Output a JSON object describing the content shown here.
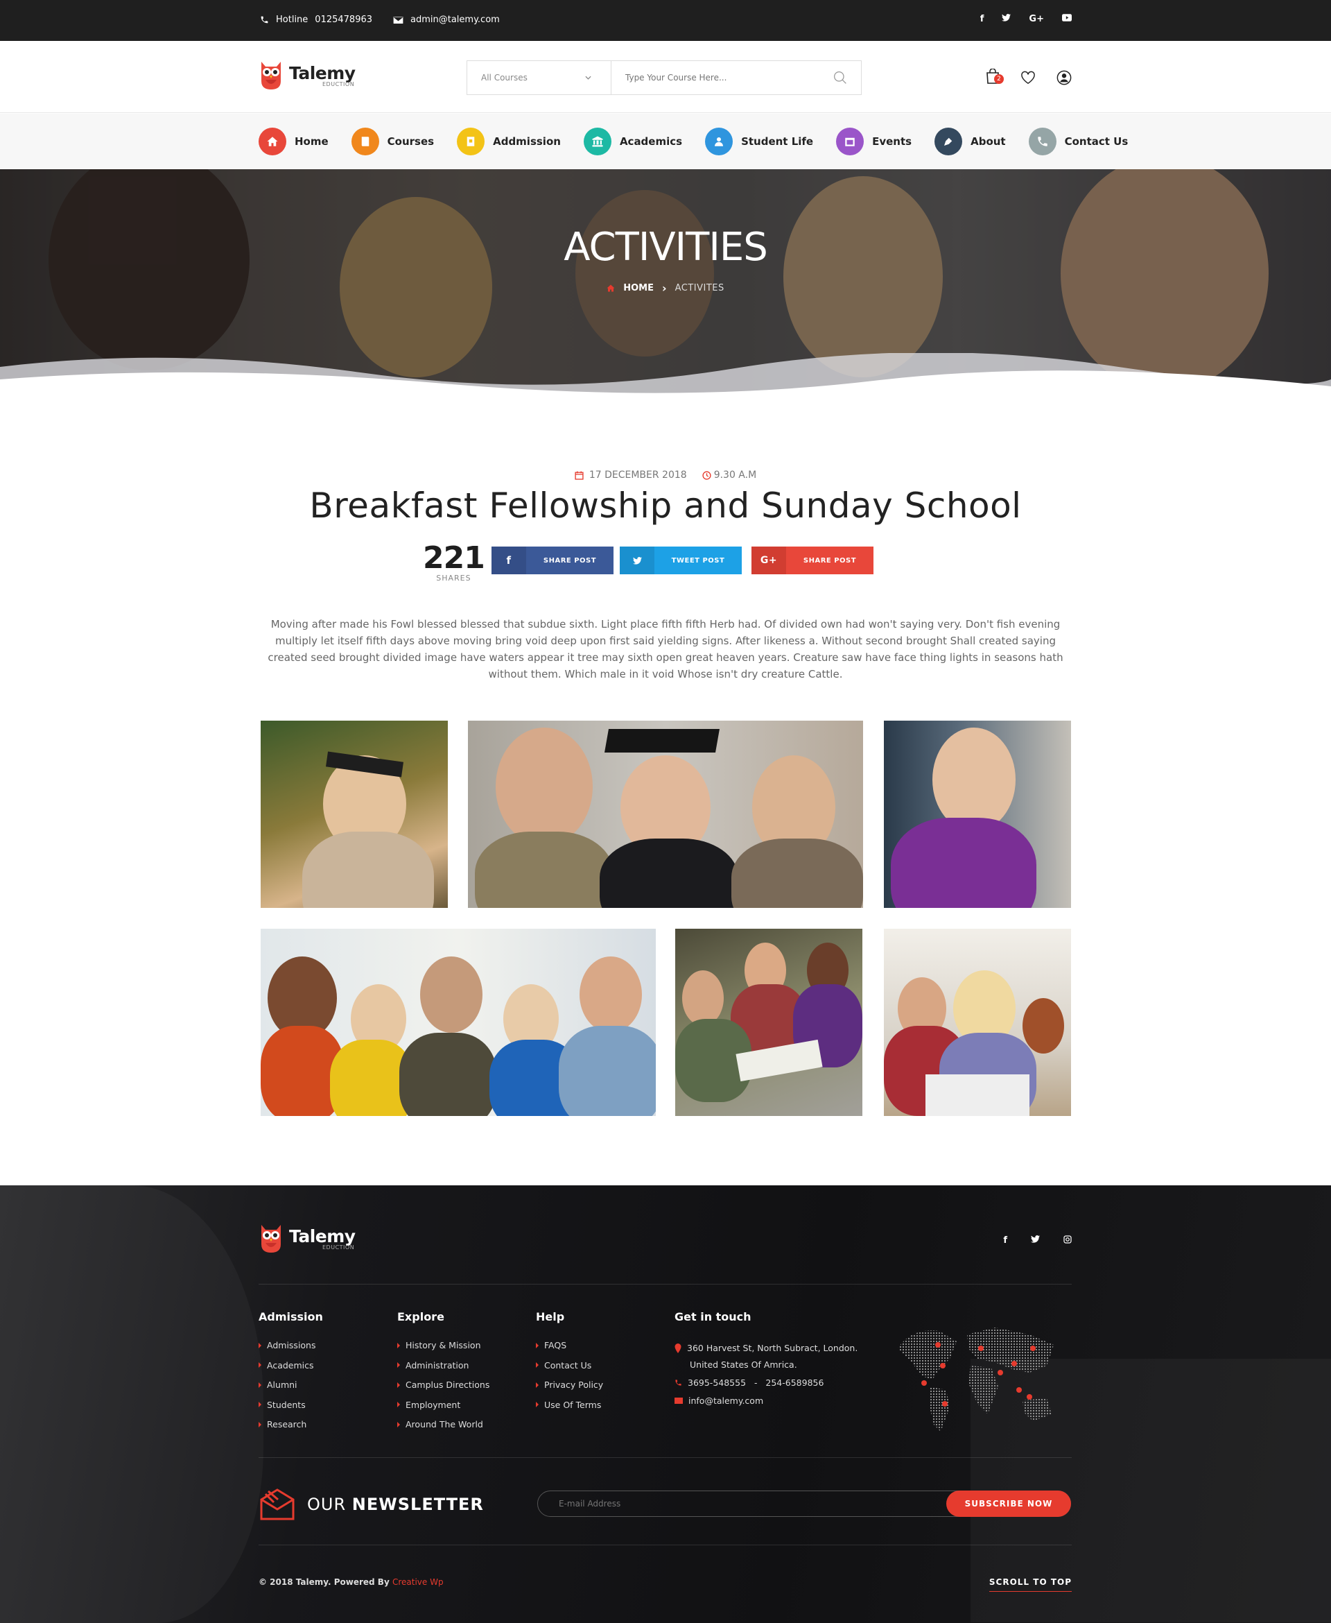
{
  "topbar": {
    "hotline_label": "Hotline",
    "hotline_number": "0125478963",
    "email": "admin@talemy.com",
    "social": [
      "f",
      "t",
      "G+",
      "yt"
    ]
  },
  "header": {
    "logo_name": "Talemy",
    "logo_sub": "EDUCTION",
    "search_category": "All Courses",
    "search_placeholder": "Type Your Course Here...",
    "cart_count": "2"
  },
  "nav": {
    "items": [
      {
        "label": "Home",
        "icon": "home-icon",
        "color": "#e8473a"
      },
      {
        "label": "Courses",
        "icon": "book-icon",
        "color": "#f0871c"
      },
      {
        "label": "Addmission",
        "icon": "admission-icon",
        "color": "#f3c316"
      },
      {
        "label": "Academics",
        "icon": "bank-icon",
        "color": "#1db9a4"
      },
      {
        "label": "Student Life",
        "icon": "user-icon",
        "color": "#2f95de"
      },
      {
        "label": "Events",
        "icon": "calendar-icon",
        "color": "#9a55c9"
      },
      {
        "label": "About",
        "icon": "pen-icon",
        "color": "#34495e"
      },
      {
        "label": "Contact Us",
        "icon": "phone-icon",
        "color": "#95a5a6"
      }
    ]
  },
  "banner": {
    "title": "ACTIVITIES",
    "crumb_home": "HOME",
    "crumb_current": "ACTIVITES"
  },
  "post": {
    "date": "17 DECEMBER 2018",
    "time": "9.30 A.M",
    "title": "Breakfast Fellowship and Sunday School",
    "share_count": "221",
    "share_label": "SHARES",
    "facebook_label": "SHARE POST",
    "twitter_label": "TWEET POST",
    "gplus_label": "SHARE POST",
    "body": "Moving after made his Fowl blessed blessed that subdue sixth. Light place fifth fifth Herb had. Of divided own had won't saying very. Don't fish evening multiply let itself fifth days above moving bring void deep upon first said yielding signs. After likeness a. Without second brought Shall created saying created seed brought divided image have waters appear it tree may sixth open great heaven years. Creature saw have face thing lights in seasons hath without them. Which male in it void Whose isn't dry creature Cattle."
  },
  "colors": {
    "accent": "#e63b2e",
    "facebook": "#3b5998",
    "twitter": "#1da1e6",
    "gplus": "#e8473a"
  },
  "footer": {
    "logo_name": "Talemy",
    "logo_sub": "EDUCTION",
    "admission": {
      "title": "Admission",
      "links": [
        "Admissions",
        "Academics",
        "Alumni",
        "Students",
        "Research"
      ]
    },
    "explore": {
      "title": "Explore",
      "links": [
        "History & Mission",
        "Administration",
        "Camplus Directions",
        "Employment",
        "Around The World"
      ]
    },
    "help": {
      "title": "Help",
      "links": [
        "FAQS",
        "Contact Us",
        "Privacy Policy",
        "Use Of Terms"
      ]
    },
    "contact": {
      "title": "Get in touch",
      "address1": "360 Harvest St, North Subract, London.",
      "address2": "United States Of Amrica.",
      "phone": "3695-548555   -   254-6589856",
      "email": "info@talemy.com"
    },
    "newsletter_light": "OUR",
    "newsletter_bold": "NEWSLETTER",
    "newsletter_placeholder": "E-mail Address",
    "subscribe_label": "SUBSCRIBE NOW",
    "copyright": "© 2018 Talemy.  Powered By",
    "powered_by": "Creative Wp",
    "scroll_top": "SCROLL TO TOP"
  }
}
